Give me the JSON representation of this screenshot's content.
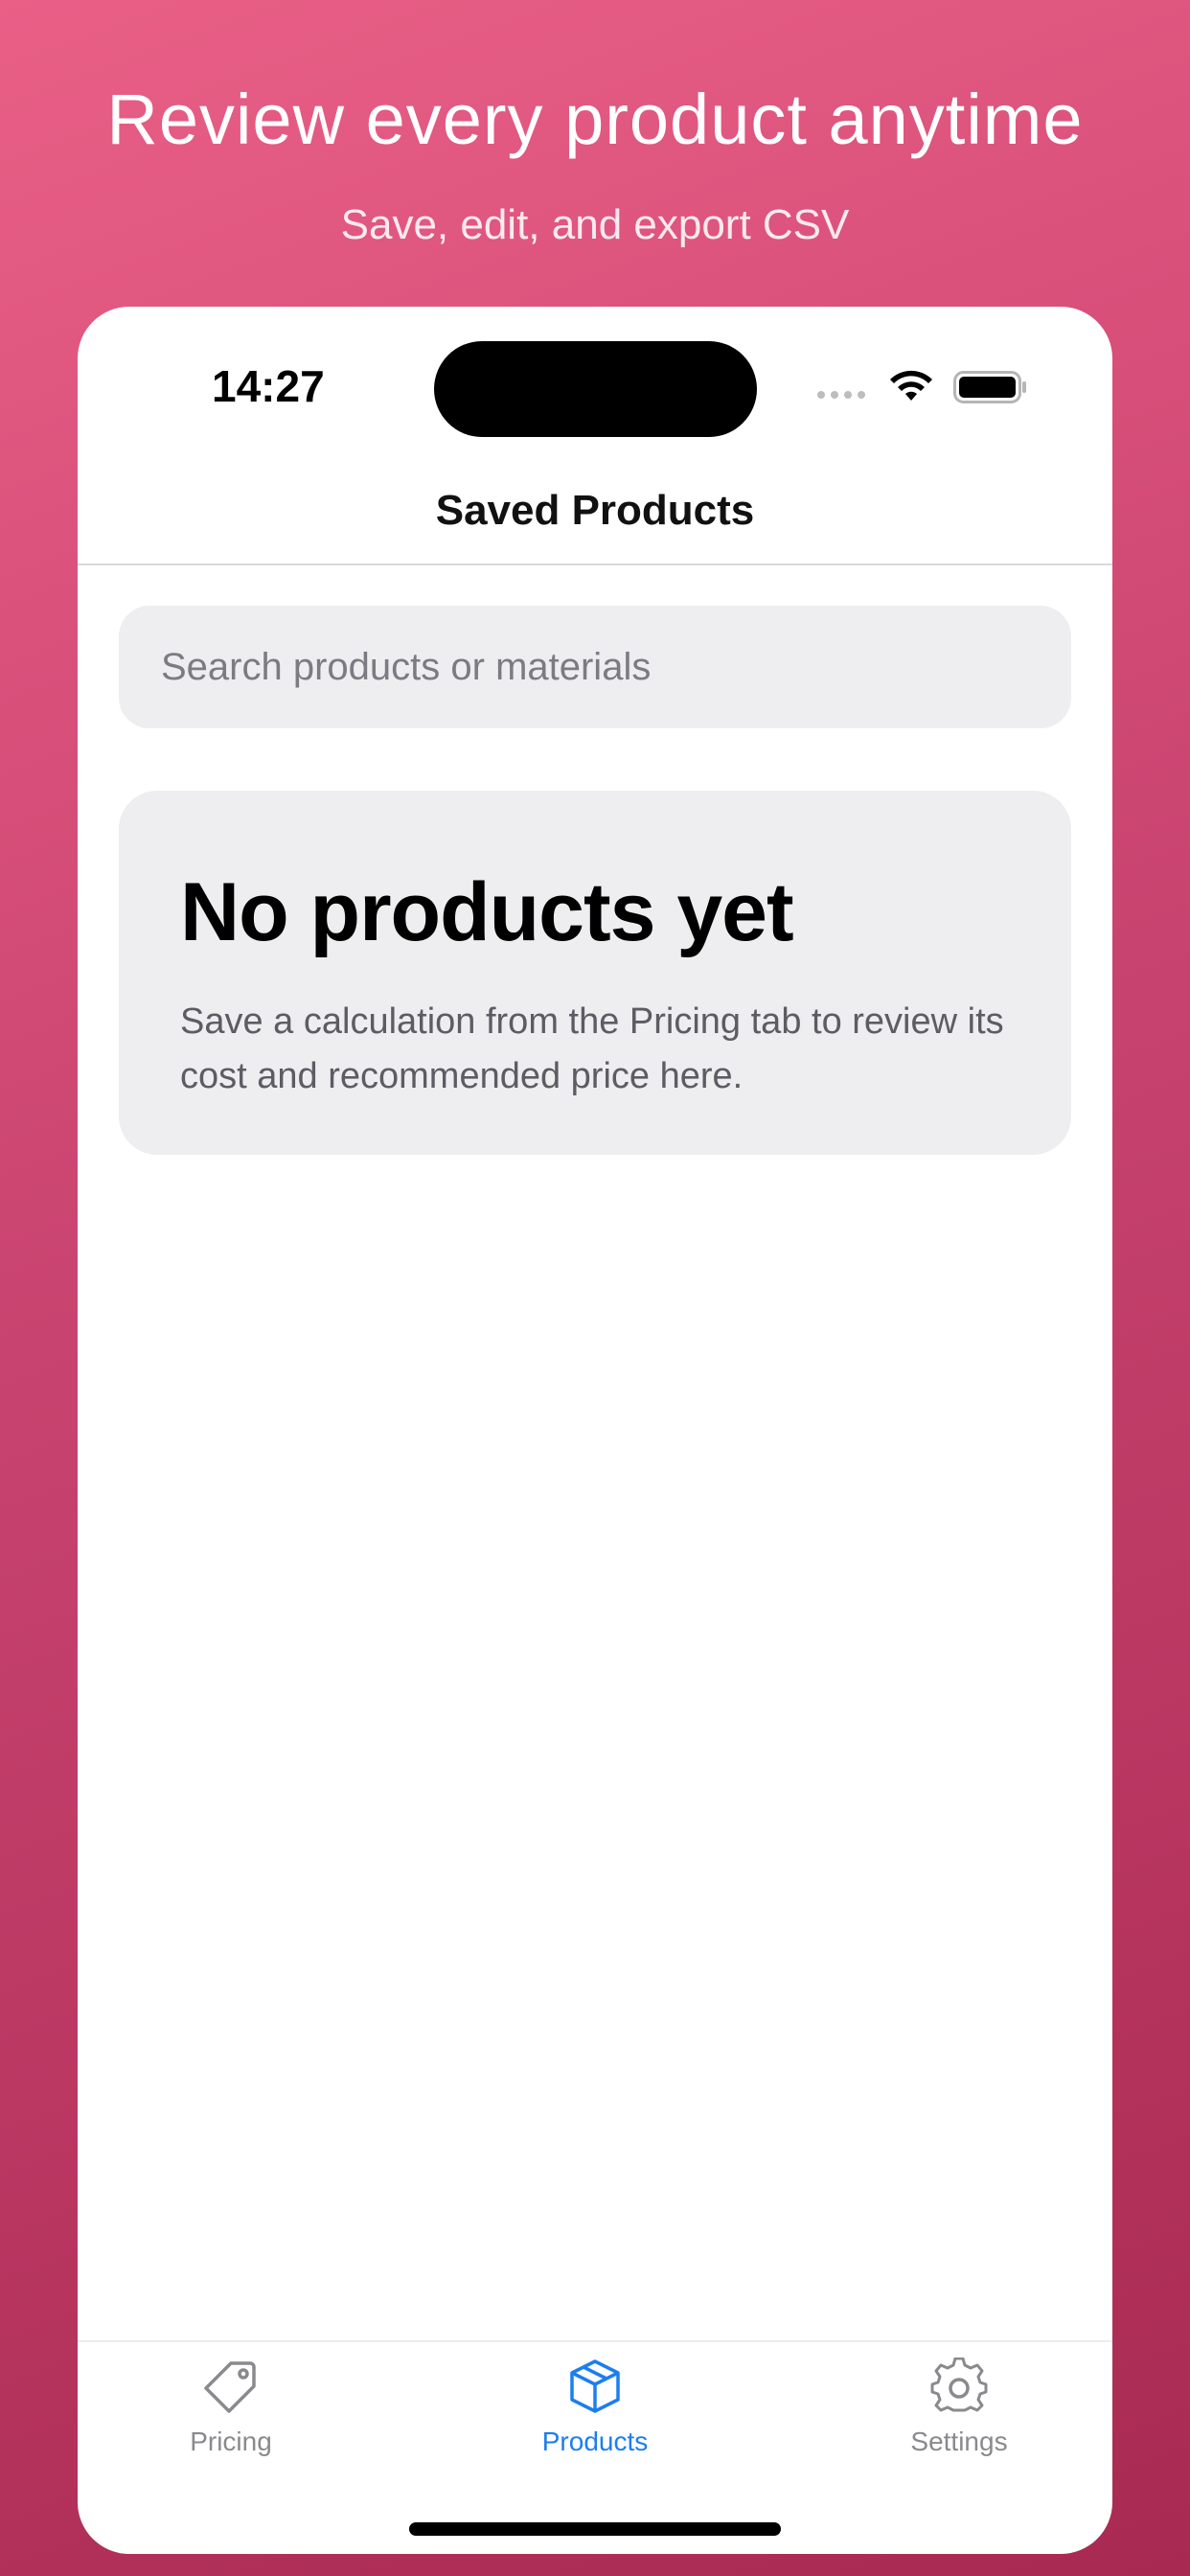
{
  "promo": {
    "headline": "Review every product anytime",
    "subline": "Save, edit, and export CSV"
  },
  "status_bar": {
    "time": "14:27",
    "icons": [
      "signal-dots-icon",
      "wifi-icon",
      "battery-icon"
    ]
  },
  "nav": {
    "title": "Saved Products"
  },
  "search": {
    "placeholder": "Search products or materials",
    "value": ""
  },
  "empty_state": {
    "title": "No products yet",
    "description": "Save a calculation from the Pricing tab to review its cost and recommended price here."
  },
  "tabs": [
    {
      "label": "Pricing",
      "icon": "tag-icon",
      "active": false
    },
    {
      "label": "Products",
      "icon": "box-icon",
      "active": true
    },
    {
      "label": "Settings",
      "icon": "gear-icon",
      "active": false
    }
  ],
  "colors": {
    "accent": "#1c7ef0",
    "background_gradient": [
      "#e95f86",
      "#a82a52"
    ],
    "inactive_tab": "#8a8a8e"
  }
}
